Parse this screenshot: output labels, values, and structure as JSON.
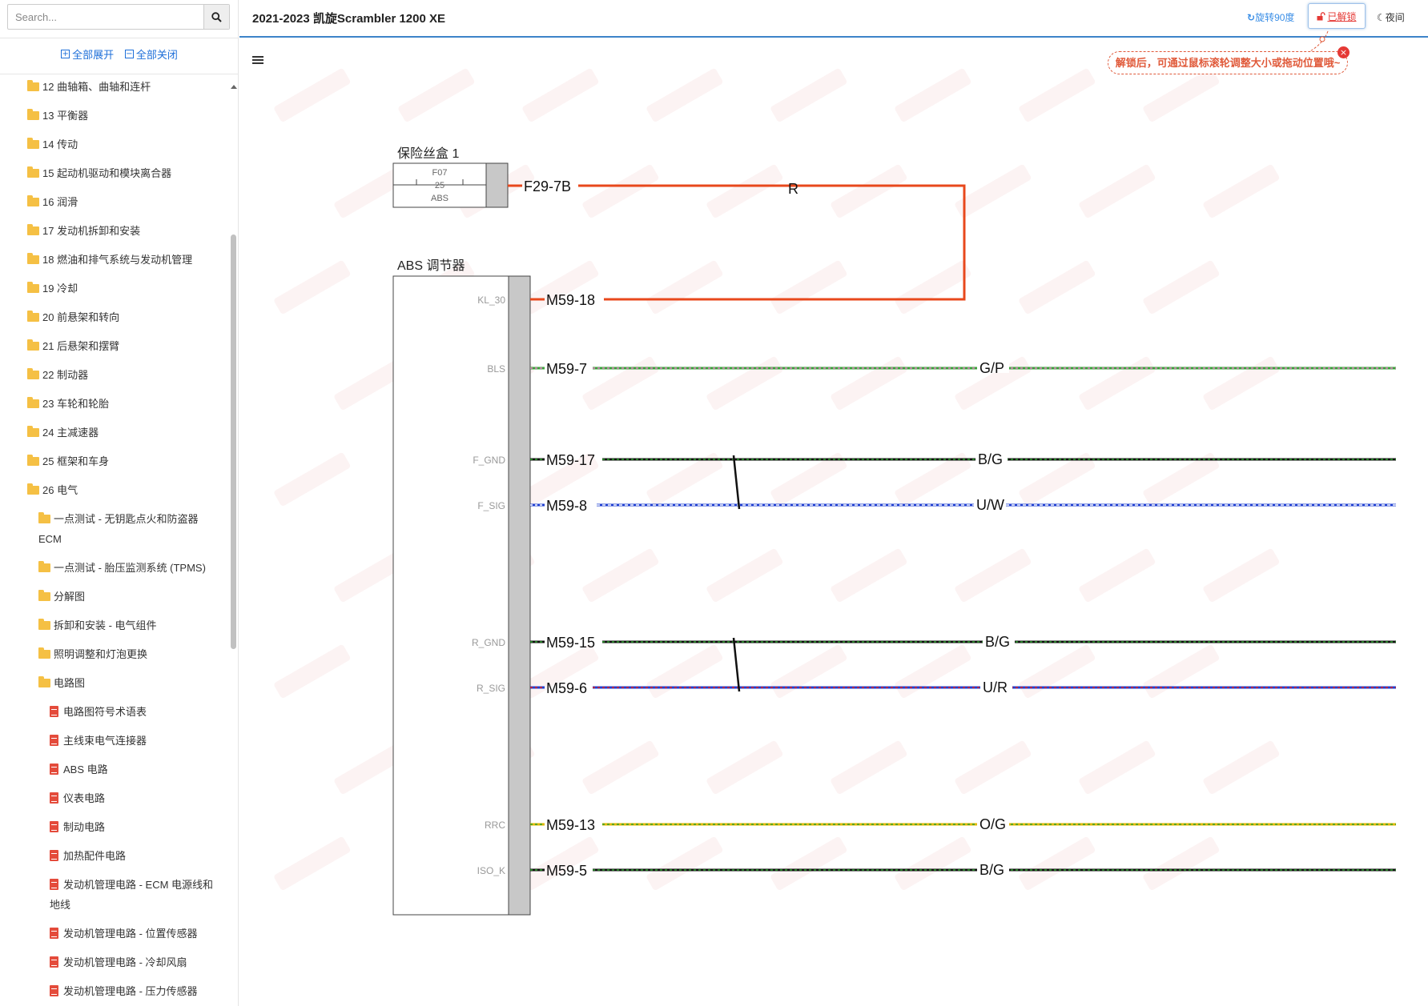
{
  "search": {
    "placeholder": "Search..."
  },
  "sidebar": {
    "expand_all": "全部展开",
    "collapse_all": "全部关闭",
    "items": [
      {
        "label": "12 曲轴箱、曲轴和连杆",
        "icon": "folder-icon"
      },
      {
        "label": "13 平衡器",
        "icon": "folder-icon"
      },
      {
        "label": "14 传动",
        "icon": "folder-icon"
      },
      {
        "label": "15 起动机驱动和模块离合器",
        "icon": "folder-icon"
      },
      {
        "label": "16 润滑",
        "icon": "folder-icon"
      },
      {
        "label": "17 发动机拆卸和安装",
        "icon": "folder-icon"
      },
      {
        "label": "18 燃油和排气系统与发动机管理",
        "icon": "folder-icon"
      },
      {
        "label": "19 冷却",
        "icon": "folder-icon"
      },
      {
        "label": "20 前悬架和转向",
        "icon": "folder-icon"
      },
      {
        "label": "21 后悬架和摆臂",
        "icon": "folder-icon"
      },
      {
        "label": "22 制动器",
        "icon": "folder-icon"
      },
      {
        "label": "23 车轮和轮胎",
        "icon": "folder-icon"
      },
      {
        "label": "24 主减速器",
        "icon": "folder-icon"
      },
      {
        "label": "25 框架和车身",
        "icon": "folder-icon"
      },
      {
        "label": "26 电气",
        "icon": "folder-icon"
      },
      {
        "label": "一点测试 - 无钥匙点火和防盗器 ECM",
        "icon": "folder-icon"
      },
      {
        "label": "一点测试 - 胎压监测系统 (TPMS)",
        "icon": "folder-icon"
      },
      {
        "label": "分解图",
        "icon": "folder-icon"
      },
      {
        "label": "拆卸和安装 - 电气组件",
        "icon": "folder-icon"
      },
      {
        "label": "照明调整和灯泡更换",
        "icon": "folder-icon"
      },
      {
        "label": "电路图",
        "icon": "folder-icon"
      },
      {
        "label": "电路图符号术语表",
        "icon": "file-icon"
      },
      {
        "label": "主线束电气连接器",
        "icon": "file-icon"
      },
      {
        "label": "ABS 电路",
        "icon": "file-icon"
      },
      {
        "label": "仪表电路",
        "icon": "file-icon"
      },
      {
        "label": "制动电路",
        "icon": "file-icon"
      },
      {
        "label": "加热配件电路",
        "icon": "file-icon"
      },
      {
        "label": "发动机管理电路 - ECM 电源线和地线",
        "icon": "file-icon"
      },
      {
        "label": "发动机管理电路 - 位置传感器",
        "icon": "file-icon"
      },
      {
        "label": "发动机管理电路 - 冷却风扇",
        "icon": "file-icon"
      },
      {
        "label": "发动机管理电路 - 压力传感器",
        "icon": "file-icon"
      }
    ]
  },
  "header": {
    "title": "2021-2023 凯旋Scrambler 1200 XE",
    "rotate_label": "旋转90度",
    "unlock_label": "已解锁",
    "night_label": "夜间",
    "tooltip": "解锁后，可通过鼠标滚轮调整大小或拖动位置哦~"
  },
  "diagram": {
    "fuse_box": {
      "title": "保险丝盒 1",
      "fuse_id": "F07",
      "fuse_rating": "25",
      "fuse_label": "ABS",
      "pin": "F29-7B"
    },
    "abs_module": {
      "title": "ABS 调节器",
      "pins": [
        {
          "name": "KL_30",
          "connector": "M59-18",
          "wire": "R",
          "colors": [
            "#e8481c"
          ]
        },
        {
          "name": "BLS",
          "connector": "M59-7",
          "wire": "G/P",
          "colors": [
            "#3aa23a",
            "#e377c2"
          ]
        },
        {
          "name": "F_GND",
          "connector": "M59-17",
          "wire": "B/G",
          "colors": [
            "#111111",
            "#2ca02c"
          ]
        },
        {
          "name": "F_SIG",
          "connector": "M59-8",
          "wire": "U/W",
          "colors": [
            "#1f3fd0",
            "#ffffff"
          ]
        },
        {
          "name": "R_GND",
          "connector": "M59-15",
          "wire": "B/G",
          "colors": [
            "#111111",
            "#2ca02c"
          ]
        },
        {
          "name": "R_SIG",
          "connector": "M59-6",
          "wire": "U/R",
          "colors": [
            "#1f3fd0",
            "#e01b1b"
          ]
        },
        {
          "name": "RRC",
          "connector": "M59-13",
          "wire": "O/G",
          "colors": [
            "#e0b800",
            "#2ca02c"
          ]
        },
        {
          "name": "ISO_K",
          "connector": "M59-5",
          "wire": "B/G",
          "colors": [
            "#111111",
            "#2ca02c"
          ]
        }
      ]
    }
  }
}
